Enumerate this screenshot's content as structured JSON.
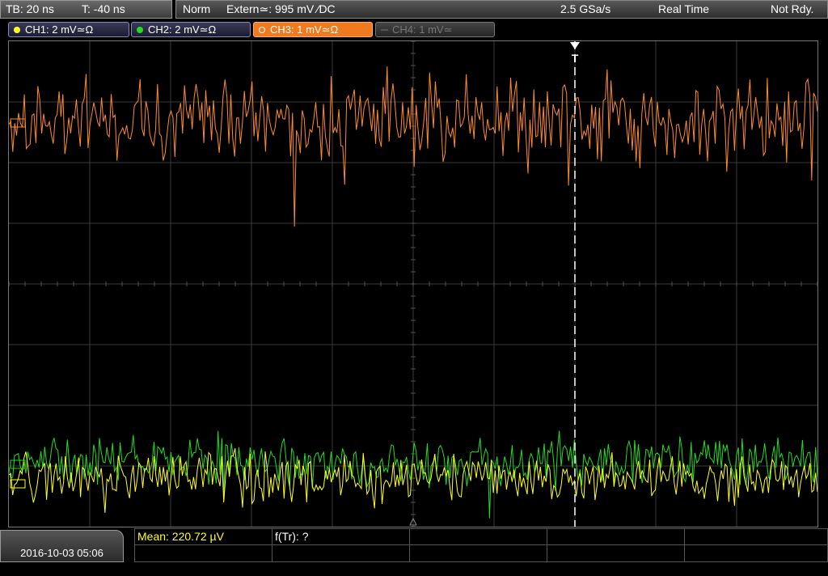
{
  "status": {
    "timebase": "TB: 20 ns",
    "trigger_time": "T: -40 ns",
    "trigger_mode": "Norm",
    "trigger_source": "Extern≃: 995 mV ∕DC",
    "sample_rate": "2.5 GSa/s",
    "acq_mode": "Real Time",
    "run_state": "Not Rdy."
  },
  "channels": [
    {
      "label": "CH1: 2 mV≃Ω",
      "color": "#ffff22",
      "active": true
    },
    {
      "label": "CH2: 2 mV≃Ω",
      "color": "#22dd22",
      "active": true
    },
    {
      "label": "CH3: 1 mV≃Ω",
      "color": "#ff8c2a",
      "active": true,
      "selected": true
    },
    {
      "label": "CH4: 1 mV≃",
      "color": "#666666",
      "active": false
    }
  ],
  "footer": {
    "datetime": "2016-10-03 05:06",
    "measurement_1": "Mean: 220.72 µV",
    "measurement_2": "f(Tr): ?"
  },
  "trigger_marker": "T",
  "colors": {
    "ch1": "#ffff22",
    "ch2": "#22dd22",
    "ch3": "#ff8c2a",
    "ch4": "#666666",
    "grid": "#3a3a3a",
    "background": "#000000"
  }
}
